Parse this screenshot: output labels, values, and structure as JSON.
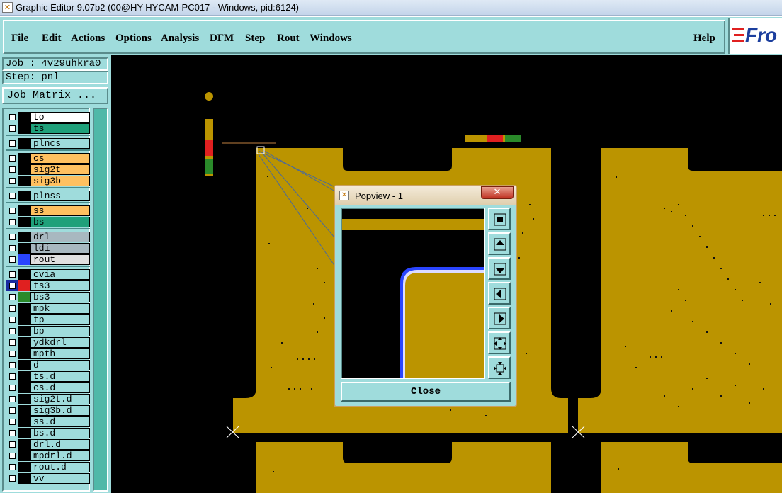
{
  "window": {
    "title": "Graphic Editor 9.07b2 (00@HY-HYCAM-PC017 - Windows, pid:6124)"
  },
  "menu": {
    "items": [
      "File",
      "Edit",
      "Actions",
      "Options",
      "Analysis",
      "DFM",
      "Step",
      "Rout",
      "Windows"
    ],
    "help": "Help"
  },
  "logo": {
    "text": "Fro"
  },
  "job": {
    "label": "Job : 4v29uhkra0",
    "step": "Step: pnl",
    "matrix_button": "Job Matrix ..."
  },
  "layers": [
    {
      "name": "to",
      "color": "#ffffff"
    },
    {
      "name": "ts",
      "color": "#1fa07a"
    },
    {
      "name": "plncs",
      "color": "#9fdcdc"
    },
    {
      "name": "cs",
      "color": "#ffc060"
    },
    {
      "name": "sig2t",
      "color": "#ffc060"
    },
    {
      "name": "sig3b",
      "color": "#ffc060"
    },
    {
      "name": "plnss",
      "color": "#9fdcdc"
    },
    {
      "name": "ss",
      "color": "#ffc060"
    },
    {
      "name": "bs",
      "color": "#1fa07a"
    },
    {
      "name": "drl",
      "color": "#a8b8c0"
    },
    {
      "name": "ldi",
      "color": "#a8b8c0"
    },
    {
      "name": "rout",
      "color": "#e0e0e0"
    },
    {
      "name": "cvia",
      "color": "#9fdcdc"
    },
    {
      "name": "ts3",
      "color": "#9fdcdc"
    },
    {
      "name": "bs3",
      "color": "#9fdcdc"
    },
    {
      "name": "mpk",
      "color": "#9fdcdc"
    },
    {
      "name": "tp",
      "color": "#9fdcdc"
    },
    {
      "name": "bp",
      "color": "#9fdcdc"
    },
    {
      "name": "ydkdrl",
      "color": "#9fdcdc"
    },
    {
      "name": "mpth",
      "color": "#9fdcdc"
    },
    {
      "name": "d",
      "color": "#9fdcdc"
    },
    {
      "name": "ts.d",
      "color": "#9fdcdc"
    },
    {
      "name": "cs.d",
      "color": "#9fdcdc"
    },
    {
      "name": "sig2t.d",
      "color": "#9fdcdc"
    },
    {
      "name": "sig3b.d",
      "color": "#9fdcdc"
    },
    {
      "name": "ss.d",
      "color": "#9fdcdc"
    },
    {
      "name": "bs.d",
      "color": "#9fdcdc"
    },
    {
      "name": "drl.d",
      "color": "#9fdcdc"
    },
    {
      "name": "mpdrl.d",
      "color": "#9fdcdc"
    },
    {
      "name": "rout.d",
      "color": "#9fdcdc"
    },
    {
      "name": "vv",
      "color": "#9fdcdc"
    }
  ],
  "popview": {
    "title": "Popview - 1",
    "close": "Close"
  },
  "colors": {
    "board": "#bb9400",
    "panel": "#9fdcdc",
    "accent_blue": "#2a45ff"
  }
}
